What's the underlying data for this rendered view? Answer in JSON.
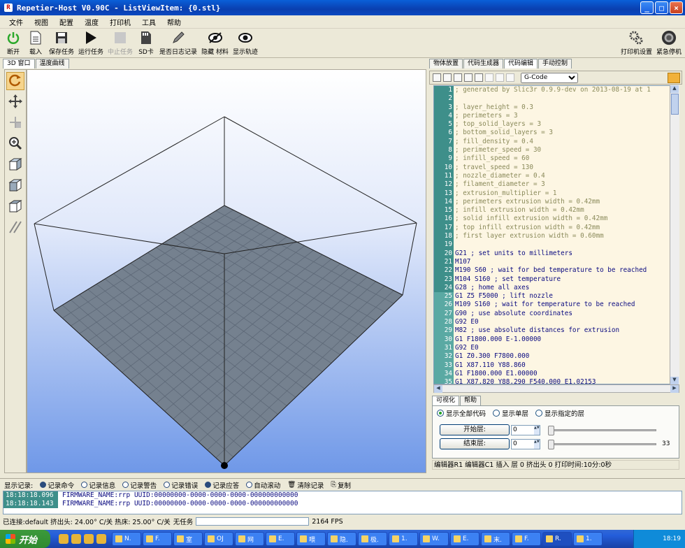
{
  "window": {
    "title": "Repetier-Host V0.90C - ListViewItem: {0.stl}"
  },
  "menu": [
    "文件",
    "视图",
    "配置",
    "温度",
    "打印机",
    "工具",
    "帮助"
  ],
  "toolbar": {
    "items": [
      {
        "label": "断开",
        "icon": "power-icon",
        "enabled": true
      },
      {
        "label": "载入",
        "icon": "document-icon",
        "enabled": true
      },
      {
        "label": "保存任务",
        "icon": "save-icon",
        "enabled": true
      },
      {
        "label": "运行任务",
        "icon": "play-icon",
        "enabled": true
      },
      {
        "label": "中止任务",
        "icon": "stop-icon",
        "enabled": false
      },
      {
        "label": "SD卡",
        "icon": "sd-card-icon",
        "enabled": true
      },
      {
        "label": "是否日志记录",
        "icon": "pencil-icon",
        "enabled": true
      },
      {
        "label": "隐藏 材料",
        "icon": "eye-slash-icon",
        "enabled": true
      },
      {
        "label": "显示轨迹",
        "icon": "eye-icon",
        "enabled": true
      }
    ],
    "right": [
      {
        "label": "打印机设置",
        "icon": "gears-icon"
      },
      {
        "label": "紧急停机",
        "icon": "emergency-stop-icon"
      }
    ]
  },
  "left_tabs": [
    "3D 窗口",
    "温度曲线"
  ],
  "right_tabs": [
    "物体放置",
    "代码生成器",
    "代码编辑",
    "手动控制"
  ],
  "editor": {
    "file_select": "G-Code",
    "lines": [
      {
        "n": "1",
        "text": "; generated by Slic3r 0.9.9-dev on 2013-08-19 at 1",
        "gcode": false
      },
      {
        "n": "2",
        "text": "",
        "gcode": false
      },
      {
        "n": "3",
        "text": "; layer_height = 0.3",
        "gcode": false
      },
      {
        "n": "4",
        "text": "; perimeters = 3",
        "gcode": false
      },
      {
        "n": "5",
        "text": "; top_solid_layers = 3",
        "gcode": false
      },
      {
        "n": "6",
        "text": "; bottom_solid_layers = 3",
        "gcode": false
      },
      {
        "n": "7",
        "text": "; fill_density = 0.4",
        "gcode": false
      },
      {
        "n": "8",
        "text": "; perimeter_speed = 30",
        "gcode": false
      },
      {
        "n": "9",
        "text": "; infill_speed = 60",
        "gcode": false
      },
      {
        "n": "10",
        "text": "; travel_speed = 130",
        "gcode": false
      },
      {
        "n": "11",
        "text": "; nozzle_diameter = 0.4",
        "gcode": false
      },
      {
        "n": "12",
        "text": "; filament_diameter = 3",
        "gcode": false
      },
      {
        "n": "13",
        "text": "; extrusion_multiplier = 1",
        "gcode": false
      },
      {
        "n": "14",
        "text": "; perimeters extrusion width = 0.42mm",
        "gcode": false
      },
      {
        "n": "15",
        "text": "; infill extrusion width = 0.42mm",
        "gcode": false
      },
      {
        "n": "16",
        "text": "; solid infill extrusion width = 0.42mm",
        "gcode": false
      },
      {
        "n": "17",
        "text": "; top infill extrusion width = 0.42mm",
        "gcode": false
      },
      {
        "n": "18",
        "text": "; first layer extrusion width = 0.60mm",
        "gcode": false
      },
      {
        "n": "19",
        "text": "",
        "gcode": false
      },
      {
        "n": "20",
        "text": "G21 ; set units to millimeters",
        "gcode": true
      },
      {
        "n": "21",
        "text": "M107",
        "gcode": true
      },
      {
        "n": "22",
        "text": "M190 S60 ; wait for bed temperature to be reached",
        "gcode": true
      },
      {
        "n": "23",
        "text": "M104 S160 ; set temperature",
        "gcode": true
      },
      {
        "n": "24",
        "text": "G28 ; home all axes",
        "gcode": true
      },
      {
        "n": "25",
        "text": "G1 Z5 F5000 ; lift nozzle",
        "gcode": true
      },
      {
        "n": "26",
        "text": "M109 S160 ; wait for temperature to be reached",
        "gcode": true
      },
      {
        "n": "27",
        "text": "G90 ; use absolute coordinates",
        "gcode": true
      },
      {
        "n": "28",
        "text": "G92 E0",
        "gcode": true
      },
      {
        "n": "29",
        "text": "M82 ; use absolute distances for extrusion",
        "gcode": true
      },
      {
        "n": "30",
        "text": "G1 F1800.000 E-1.00000",
        "gcode": true
      },
      {
        "n": "31",
        "text": "G92 E0",
        "gcode": true
      },
      {
        "n": "32",
        "text": "G1 Z0.300 F7800.000",
        "gcode": true
      },
      {
        "n": "33",
        "text": "G1 X87.110 Y88.860",
        "gcode": true
      },
      {
        "n": "34",
        "text": "G1 F1800.000 E1.00000",
        "gcode": true
      },
      {
        "n": "35",
        "text": "G1 X87.820 Y88.290 F540.000 E1.02153",
        "gcode": true
      }
    ]
  },
  "visual": {
    "tabs": [
      "可视化",
      "帮助"
    ],
    "radios": [
      "显示全部代码",
      "显示单层",
      "显示指定的层"
    ],
    "start_layer_label": "开始层:",
    "end_layer_label": "结束层:",
    "start_value": "0",
    "end_value": "0",
    "slider_max": "33"
  },
  "editor_status": "编辑器R1 编辑器C1 插入 层 0 挤出头 0 打印时间:10分:0秒",
  "log": {
    "label": "显示记录:",
    "options": [
      {
        "label": "记录命令",
        "on": true
      },
      {
        "label": "记录信息",
        "on": false
      },
      {
        "label": "记录警告",
        "on": false
      },
      {
        "label": "记录错误",
        "on": false
      },
      {
        "label": "记录应答",
        "on": true
      },
      {
        "label": "自动滚动",
        "on": false
      }
    ],
    "clear_label": "清除记录",
    "copy_label": "复制",
    "lines": [
      {
        "time": "18:18:18.096",
        "msg": "FIRMWARE_NAME:rrp UUID:00000000-0000-0000-0000-000000000000"
      },
      {
        "time": "18:18:18.143",
        "msg": "FIRMWARE_NAME:rrp UUID:00000000-0000-0000-0000-000000000000"
      }
    ]
  },
  "status": {
    "conn": "已连接:default 挤出头: 24.00° C/关 热床: 25.00° C/关",
    "task": "无任务",
    "fps": "2164 FPS"
  },
  "taskbar": {
    "start": "开始",
    "buttons": [
      "N.",
      "F.",
      "室",
      "OJ",
      "网",
      "E.",
      "喂",
      "隐.",
      "极.",
      "1.",
      "W.",
      "E.",
      "末.",
      "F.",
      "R.",
      "1."
    ],
    "clock": "18:19"
  },
  "colors": {
    "bed": "#75818f",
    "viewport_top": "#ffffff",
    "viewport_bottom": "#6f98e8",
    "line_numbers": "#3e8f8a"
  }
}
